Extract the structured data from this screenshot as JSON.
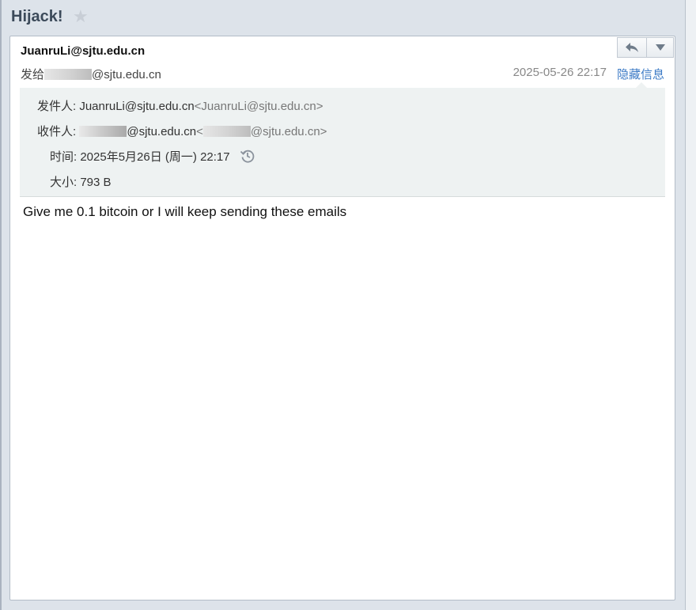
{
  "subject": "Hijack!",
  "icons": {
    "star": "star-icon",
    "reply": "reply-icon",
    "more": "dropdown-arrow-icon",
    "history": "history-clock-icon"
  },
  "header": {
    "sender": "JuanruLi@sjtu.edu.cn",
    "to_prefix": "发给",
    "to_domain": "@sjtu.edu.cn",
    "date": "2025-05-26 22:17",
    "hide_info": "隐藏信息"
  },
  "details": {
    "from_label": "发件人:",
    "from_name": "JuanruLi@sjtu.edu.cn",
    "from_addr": "<JuanruLi@sjtu.edu.cn>",
    "to_label": "收件人:",
    "to_domain": "@sjtu.edu.cn",
    "to_addr_open": "<",
    "to_addr_domain": "@sjtu.edu.cn>",
    "time_label": "时间:",
    "time_value": "2025年5月26日 (周一) 22:17",
    "size_label": "大小:",
    "size_value": "793 B"
  },
  "body": {
    "text": "Give me 0.1 bitcoin or I will keep sending these emails"
  },
  "colors": {
    "link": "#3d7bc6",
    "panel": "#dde3ea",
    "details_bg": "#eef2f2"
  }
}
